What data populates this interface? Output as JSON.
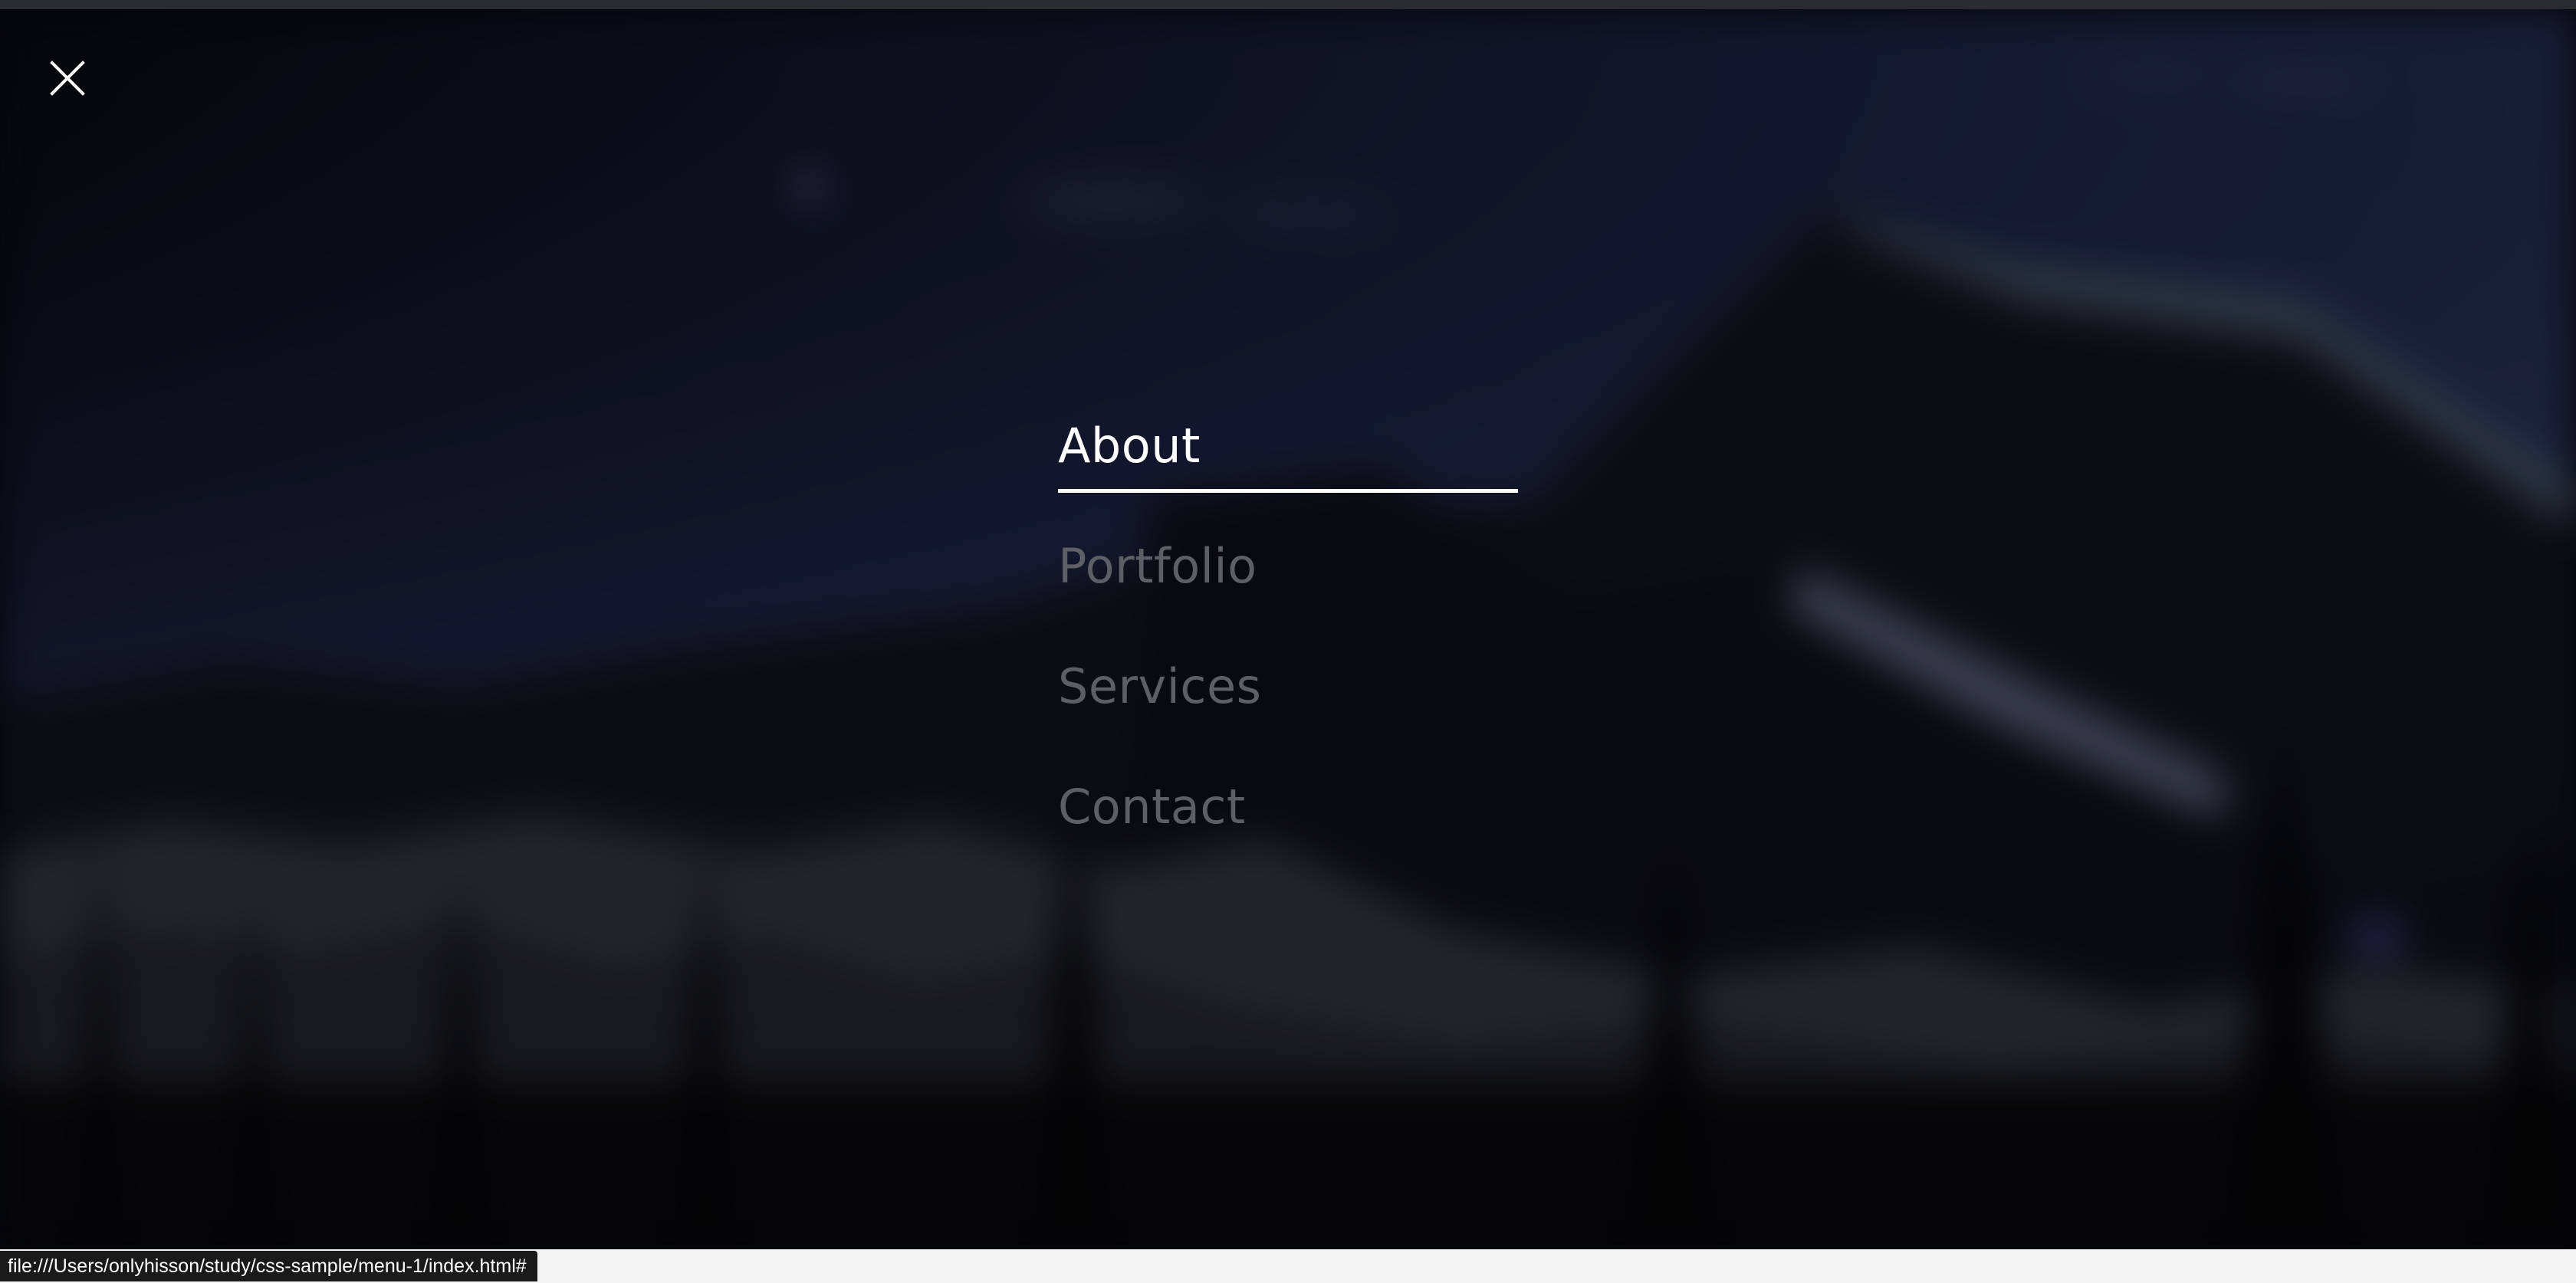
{
  "overlay_menu": {
    "close_icon": "close-icon",
    "items": [
      {
        "label": "About",
        "active": true
      },
      {
        "label": "Portfolio",
        "active": false
      },
      {
        "label": "Services",
        "active": false
      },
      {
        "label": "Contact",
        "active": false
      }
    ]
  },
  "status_bar": {
    "url": "file:///Users/onlyhisson/study/css-sample/menu-1/index.html#"
  },
  "colors": {
    "active_text": "#ffffff",
    "inactive_text": "#5d5f66",
    "sky": "#1b2140",
    "mountain": "#101118"
  }
}
